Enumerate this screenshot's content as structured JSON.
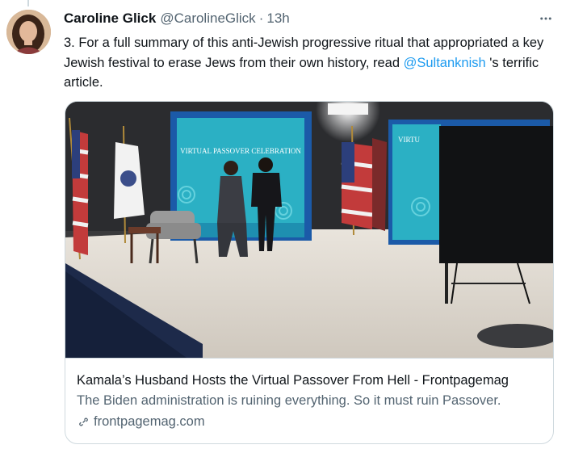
{
  "tweet": {
    "author_name": "Caroline Glick",
    "author_handle": "@CarolineGlick",
    "separator": "·",
    "time": "13h",
    "text_before": "3. For a full summary of this anti-Jewish progressive ritual that appropriated a key Jewish festival to erase Jews from their own history, read ",
    "mention": "@Sultanknish",
    "text_after": " 's terrific article."
  },
  "card": {
    "image_sign_text": "VIRTUAL PASSOVER CELEBRATION",
    "image_sign_text_right": "VIRTU",
    "title": "Kamala’s Husband Hosts the Virtual Passover From Hell - Frontpagemag",
    "description": "The Biden administration is ruining everything. So it must ruin Passover.",
    "domain": "frontpagemag.com"
  },
  "icons": {
    "more": "more-horizontal-icon",
    "link": "link-icon"
  },
  "colors": {
    "accent": "#1d9bf0",
    "secondary_text": "#536471",
    "border": "#cfd9de"
  }
}
